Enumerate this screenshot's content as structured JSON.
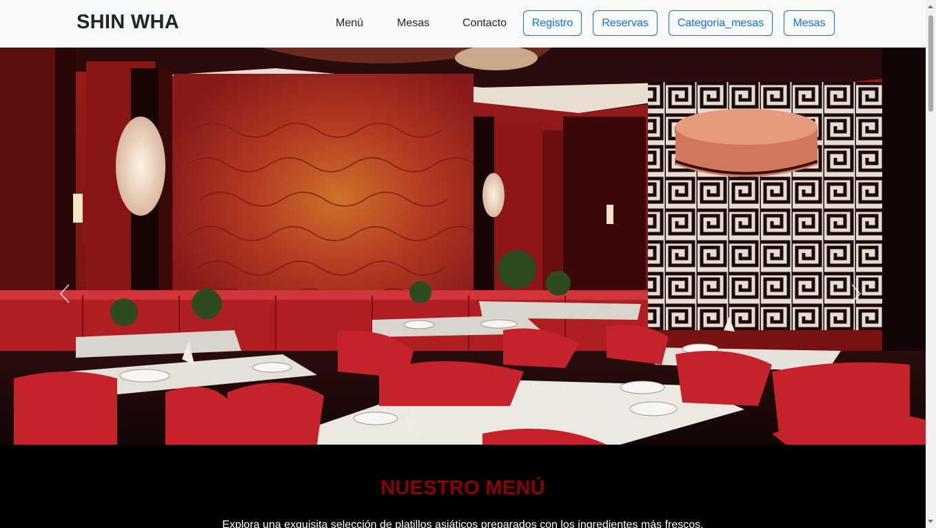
{
  "navbar": {
    "brand": "SHIN WHA",
    "links": [
      {
        "label": "Menú"
      },
      {
        "label": "Mesas"
      },
      {
        "label": "Contacto"
      }
    ],
    "buttons": [
      {
        "label": "Registro"
      },
      {
        "label": "Reservas"
      },
      {
        "label": "Categoria_mesas"
      },
      {
        "label": "Mesas"
      }
    ],
    "button_color": "#0d6efd",
    "background": "#f8f9fa"
  },
  "carousel": {
    "image_description_icon": "restaurant-interior-image",
    "prev_icon": "chevron-left-icon",
    "next_icon": "chevron-right-icon"
  },
  "menu_section": {
    "title": "NUESTRO MENÚ",
    "title_color": "#8b0000",
    "description": "Explora una exquisita selección de platillos asiáticos preparados con los ingredientes más frescos."
  }
}
